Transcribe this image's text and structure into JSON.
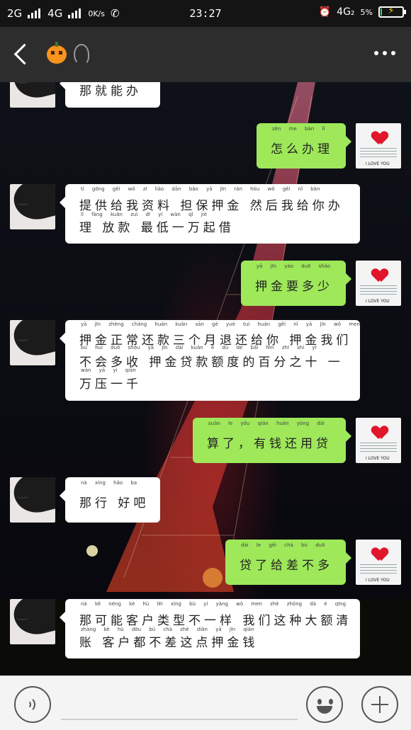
{
  "status_bar": {
    "network_1": "2G",
    "network_2": "4G",
    "speed": "0K/s",
    "time": "23:27",
    "network_3": "4G₂",
    "battery_percent": "5%",
    "battery_level": 0.05
  },
  "header": {
    "back_icon": "chevron-left-icon",
    "title_icon": "pumpkin-icon",
    "mode_icon": "ear-icon",
    "menu_icon": "more-dots-icon"
  },
  "messages": [
    {
      "side": "left",
      "lines": [
        "那就能办"
      ],
      "pinyin": [
        ""
      ]
    },
    {
      "side": "right",
      "lines": [
        "怎么办理"
      ],
      "pinyin": [
        "zěn me bàn lǐ"
      ]
    },
    {
      "side": "left",
      "lines": [
        "提供给我资料 担保押金 然后我给你办",
        "理 放款 最低一万起借"
      ],
      "pinyin": [
        "tí gōng gěi wǒ zī liào dān bǎo yā jīn rán hòu wǒ gěi nǐ bàn",
        "lǐ fàng kuǎn zuì dī yí wàn qǐ jiè"
      ]
    },
    {
      "side": "right",
      "lines": [
        "押金要多少"
      ],
      "pinyin": [
        "yā jīn yào duō shǎo"
      ]
    },
    {
      "side": "left",
      "lines": [
        "押金正常还款三个月退还给你 押金我们",
        "不会多收 押金贷款额度的百分之十 一",
        "万压一千"
      ],
      "pinyin": [
        "yā jīn zhèng cháng huán kuǎn sān gè yuè tuì huán gěi nǐ yā jīn wǒ men",
        "bú huì duō shōu yā jīn dài kuǎn é dù de bǎi fēn zhī shí yī",
        "wàn yā yì qiān"
      ]
    },
    {
      "side": "right",
      "lines": [
        "算了，有钱还用贷"
      ],
      "pinyin": [
        "suàn le yǒu qián huán yòng dài"
      ]
    },
    {
      "side": "left",
      "lines": [
        "那行 好吧"
      ],
      "pinyin": [
        "nà xíng hǎo ba"
      ]
    },
    {
      "side": "right",
      "lines": [
        "贷了给差不多"
      ],
      "pinyin": [
        "dài le gěi chà bù duō"
      ]
    },
    {
      "side": "left",
      "lines": [
        "那可能客户类型不一样 我们这种大额清",
        "账 客户都不差这点押金钱"
      ],
      "pinyin": [
        "nà kě néng kè hù lèi xíng bù yí yàng wǒ men zhè zhǒng dà é qīng",
        "zhàng kè hù dōu bú chà zhè diǎn yā jīn qián"
      ]
    }
  ],
  "right_avatar_text": "I LOVE YOU",
  "bottom_bar": {
    "voice_icon": "voice-icon",
    "emoji_icon": "emoji-icon",
    "plus_icon": "plus-icon"
  },
  "colors": {
    "green_bubble": "#9ee85a",
    "white_bubble": "#ffffff",
    "title_bar": "#2d2d2d"
  }
}
